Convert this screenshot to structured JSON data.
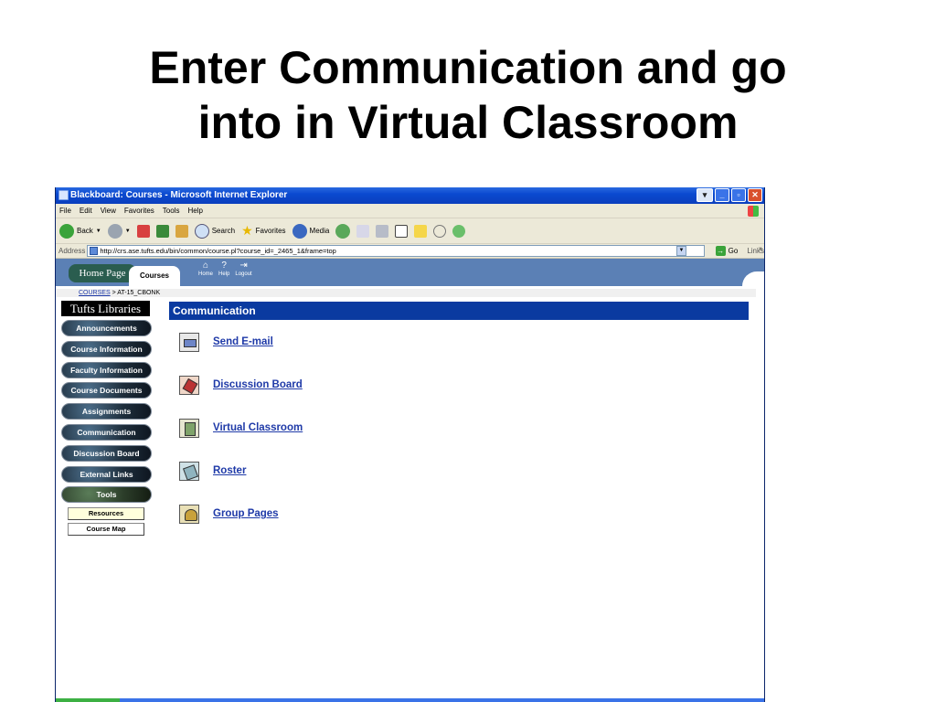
{
  "slide": {
    "title_line1": "Enter Communication and go",
    "title_line2": "into in Virtual Classroom"
  },
  "window": {
    "title": "Blackboard: Courses - Microsoft Internet Explorer",
    "menu": [
      "File",
      "Edit",
      "View",
      "Favorites",
      "Tools",
      "Help"
    ],
    "toolbar": {
      "back": "Back",
      "search": "Search",
      "favorites": "Favorites",
      "media": "Media"
    },
    "address_label": "Address",
    "address_url": "http://crs.ase.tufts.edu/bin/common/course.pl?course_id=_2465_1&frame=top",
    "go": "Go",
    "links": "Links"
  },
  "blackboard": {
    "tabs": {
      "home": "Home Page",
      "courses": "Courses"
    },
    "tools": [
      "Home",
      "Help",
      "Logout"
    ],
    "breadcrumb": {
      "root": "COURSES",
      "sep": " > ",
      "current": "AT-15_CBONK"
    },
    "library_header": "Tufts Libraries",
    "nav": [
      "Announcements",
      "Course Information",
      "Faculty Information",
      "Course Documents",
      "Assignments",
      "Communication",
      "Discussion Board",
      "External Links",
      "Tools"
    ],
    "sub_nav": [
      "Resources",
      "Course Map"
    ],
    "content_header": "Communication",
    "items": [
      {
        "label": "Send E-mail",
        "icon": "email-icon"
      },
      {
        "label": "Discussion Board",
        "icon": "discussion-board-icon"
      },
      {
        "label": "Virtual Classroom",
        "icon": "virtual-classroom-icon"
      },
      {
        "label": "Roster",
        "icon": "roster-icon"
      },
      {
        "label": "Group Pages",
        "icon": "group-pages-icon"
      }
    ]
  }
}
